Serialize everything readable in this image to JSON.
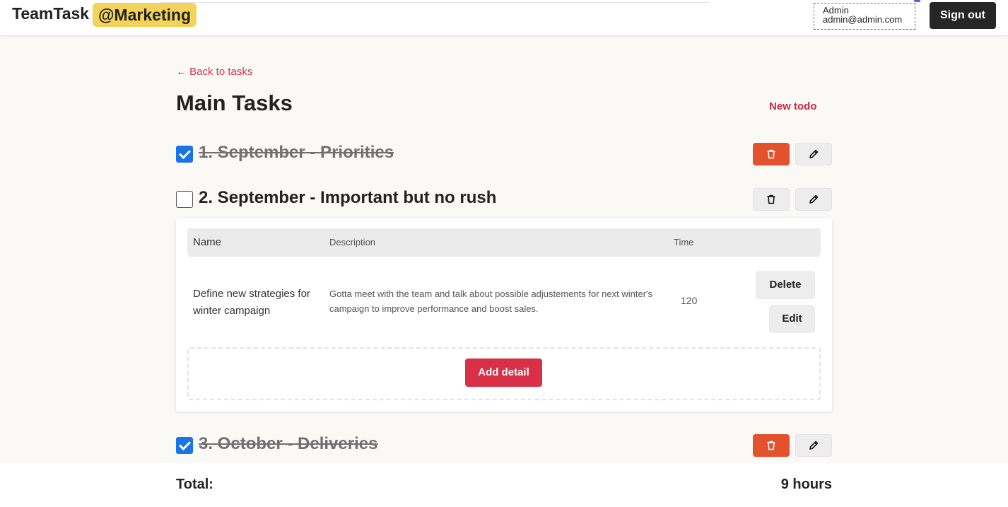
{
  "header": {
    "brand": "TeamTask",
    "team": "@Marketing",
    "user_name": "Admin",
    "user_email": "admin@admin.com",
    "sign_out": "Sign out"
  },
  "main": {
    "back_link": "← Back to tasks",
    "title": "Main Tasks",
    "new_todo": "New todo"
  },
  "tasks": [
    {
      "title": "1. September - Priorities",
      "done": true
    },
    {
      "title": "2. September - Important but no rush",
      "done": false
    },
    {
      "title": "3. October - Deliveries",
      "done": true
    }
  ],
  "details": {
    "columns": {
      "name": "Name",
      "description": "Description",
      "time": "Time"
    },
    "rows": [
      {
        "name": "Define new strategies for winter campaign",
        "description": "Gotta meet with the team and talk about possible adjustements for next winter's campaign to improve performance and boost sales.",
        "time": "120",
        "delete_label": "Delete",
        "edit_label": "Edit"
      }
    ],
    "add_detail": "Add detail"
  },
  "footer": {
    "total_label": "Total:",
    "total_value": "9 hours"
  },
  "colors": {
    "accent": "#d93048",
    "danger": "#e4512d",
    "badge": "#f3d35a",
    "checkbox": "#1a73e8"
  }
}
